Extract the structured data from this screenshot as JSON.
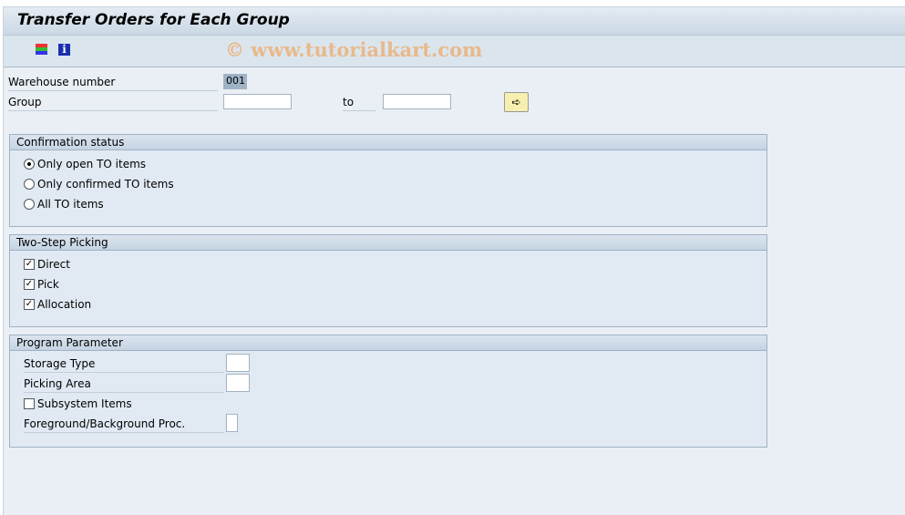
{
  "title": "Transfer Orders for Each Group",
  "watermark": "© www.tutorialkart.com",
  "toolbar": {
    "icons": [
      "multiple-selection-icon",
      "info-icon"
    ]
  },
  "fields": {
    "warehouse_label": "Warehouse number",
    "warehouse_value": "001",
    "group_label": "Group",
    "group_from": "",
    "to_label": "to",
    "group_to": ""
  },
  "confirmation": {
    "title": "Confirmation status",
    "options": [
      {
        "label": "Only open TO items",
        "selected": true
      },
      {
        "label": "Only confirmed TO items",
        "selected": false
      },
      {
        "label": "All TO items",
        "selected": false
      }
    ]
  },
  "picking": {
    "title": "Two-Step Picking",
    "items": [
      {
        "label": "Direct",
        "checked": true
      },
      {
        "label": "Pick",
        "checked": true
      },
      {
        "label": "Allocation",
        "checked": true
      }
    ]
  },
  "program": {
    "title": "Program Parameter",
    "storage_type": "Storage Type",
    "picking_area": "Picking Area",
    "subsystem": "Subsystem Items",
    "subsystem_checked": false,
    "fg_bg": "Foreground/Background Proc."
  }
}
